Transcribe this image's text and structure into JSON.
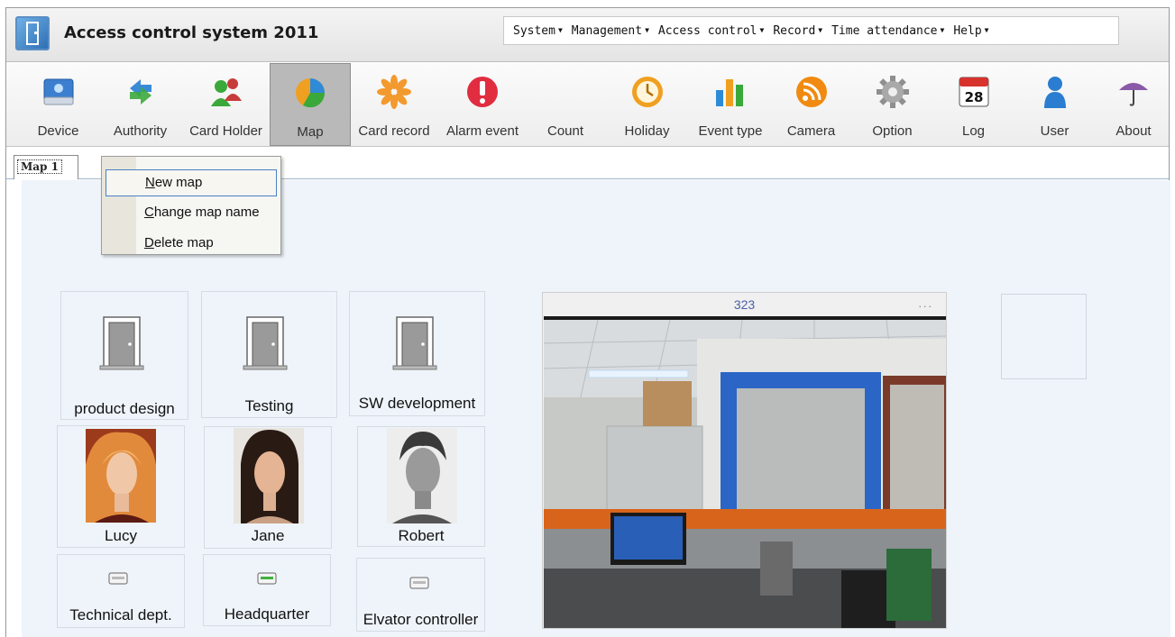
{
  "app": {
    "title": "Access control system 2011"
  },
  "menu": [
    {
      "label": "System",
      "arrow": "▼"
    },
    {
      "label": "Management",
      "arrow": "▼"
    },
    {
      "label": "Access control",
      "arrow": "▼"
    },
    {
      "label": "Record",
      "arrow": "▼"
    },
    {
      "label": "Time attendance",
      "arrow": "▼"
    },
    {
      "label": "Help",
      "arrow": "▼"
    }
  ],
  "toolbar": [
    {
      "label": "Device",
      "icon": "device-icon"
    },
    {
      "label": "Authority",
      "icon": "authority-icon"
    },
    {
      "label": "Card Holder",
      "icon": "card-holder-icon"
    },
    {
      "label": "Map",
      "icon": "map-icon",
      "active": true
    },
    {
      "label": "Card record",
      "icon": "card-record-icon"
    },
    {
      "label": "Alarm event",
      "icon": "alarm-icon"
    },
    {
      "label": "Count",
      "icon": "count-icon"
    },
    {
      "label": "Holiday",
      "icon": "holiday-icon"
    },
    {
      "label": "Event type",
      "icon": "event-type-icon"
    },
    {
      "label": "Camera",
      "icon": "camera-icon"
    },
    {
      "label": "Option",
      "icon": "option-icon"
    },
    {
      "label": "Log",
      "icon": "log-icon",
      "badge": "28"
    },
    {
      "label": "User",
      "icon": "user-icon"
    },
    {
      "label": "About",
      "icon": "about-icon"
    }
  ],
  "tabs": [
    {
      "label": "Map 1"
    }
  ],
  "context_menu": {
    "items": [
      {
        "underline": "N",
        "rest": "ew map"
      },
      {
        "underline": "C",
        "rest": "hange map name"
      },
      {
        "underline": "D",
        "rest": "elete map"
      }
    ]
  },
  "doors": [
    {
      "name": "product design"
    },
    {
      "name": "Testing"
    },
    {
      "name": "SW development"
    }
  ],
  "people": [
    {
      "name": "Lucy"
    },
    {
      "name": "Jane"
    },
    {
      "name": "Robert"
    }
  ],
  "controllers": [
    {
      "name": "Technical dept."
    },
    {
      "name": "Headquarter"
    },
    {
      "name": "Elvator controller"
    }
  ],
  "camera": {
    "title": "323",
    "dots": "...",
    "icon": "camera-feed"
  },
  "colors": {
    "accent": "#4a80c4",
    "canvas": "#eef4fa",
    "active_tool": "#b9b9b9"
  }
}
